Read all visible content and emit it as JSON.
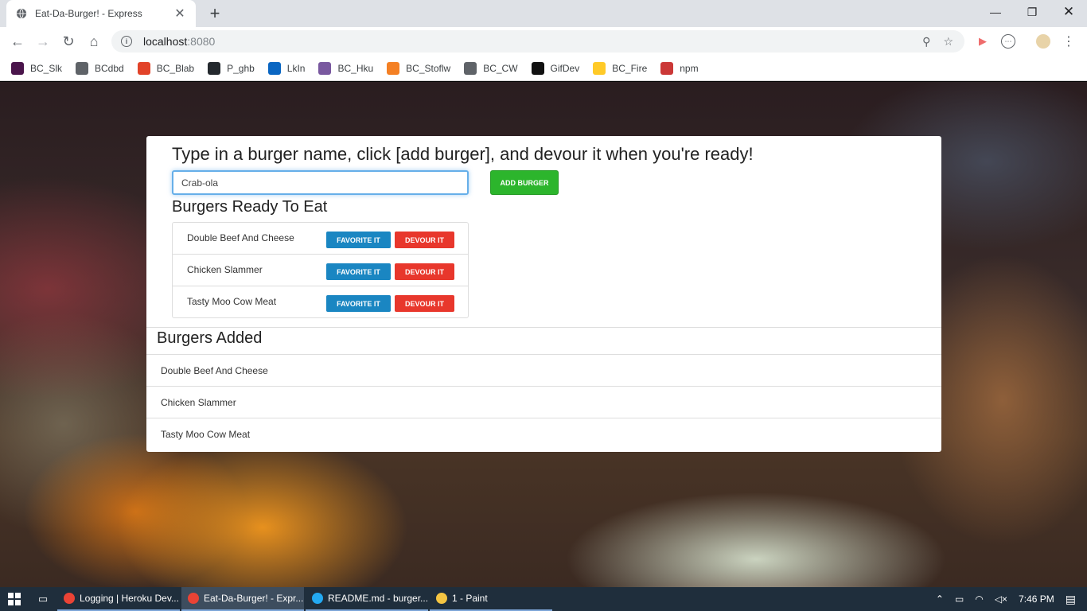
{
  "browser": {
    "tab_title": "Eat-Da-Burger! - Express",
    "url_host": "localhost",
    "url_port": ":8080",
    "bookmarks": [
      {
        "label": "BC_Slk",
        "icon": "slack-icon",
        "color": "#4a154b"
      },
      {
        "label": "BCdbd",
        "icon": "globe-icon",
        "color": "#5f6368"
      },
      {
        "label": "BC_Blab",
        "icon": "gitlab-icon",
        "color": "#e24329"
      },
      {
        "label": "P_ghb",
        "icon": "github-icon",
        "color": "#24292e"
      },
      {
        "label": "LkIn",
        "icon": "linkedin-icon",
        "color": "#0a66c2"
      },
      {
        "label": "BC_Hku",
        "icon": "heroku-icon",
        "color": "#79589f"
      },
      {
        "label": "BC_Stoflw",
        "icon": "stackoverflow-icon",
        "color": "#f48024"
      },
      {
        "label": "BC_CW",
        "icon": "globe-icon",
        "color": "#5f6368"
      },
      {
        "label": "GifDev",
        "icon": "giphy-icon",
        "color": "#111111"
      },
      {
        "label": "BC_Fire",
        "icon": "firebase-icon",
        "color": "#ffca28"
      },
      {
        "label": "npm",
        "icon": "npm-icon",
        "color": "#cb3837"
      }
    ]
  },
  "page": {
    "heading": "Type in a burger name, click [add burger], and devour it when you're ready!",
    "input_value": "Crab-ola",
    "add_button": "ADD BURGER",
    "ready_title": "Burgers Ready To Eat",
    "favorite_label": "FAVORITE IT",
    "devour_label": "DEVOUR IT",
    "ready_burgers": [
      "Double Beef And Cheese",
      "Chicken Slammer",
      "Tasty Moo Cow Meat"
    ],
    "added_title": "Burgers Added",
    "added_burgers": [
      "Double Beef And Cheese",
      "Chicken Slammer",
      "Tasty Moo Cow Meat"
    ],
    "colors": {
      "add": "#2cb52c",
      "favorite": "#1a86c2",
      "devour": "#e8372c"
    }
  },
  "taskbar": {
    "tasks": [
      {
        "label": "Logging | Heroku Dev...",
        "icon": "chrome-icon",
        "active": false
      },
      {
        "label": "Eat-Da-Burger! - Expr...",
        "icon": "chrome-icon",
        "active": true
      },
      {
        "label": "README.md - burger...",
        "icon": "vscode-icon",
        "active": false
      },
      {
        "label": "1 - Paint",
        "icon": "paint-icon",
        "active": false
      }
    ],
    "time": "7:46 PM"
  }
}
